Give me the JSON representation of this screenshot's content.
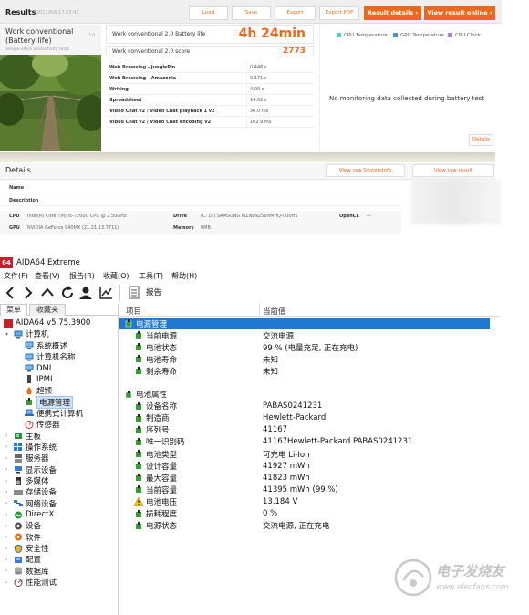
{
  "futuremark": {
    "header": {
      "title": "Results",
      "timestamp": "2017/6/6 17:53:41",
      "buttons": [
        "Load",
        "Save",
        "Export",
        "Export PDF"
      ],
      "result_details": "Result details",
      "view_online": "View result online"
    },
    "test_card": {
      "title_line1": "Work conventional",
      "title_line2": "(Battery life)",
      "subtitle": "Simple office productivity tests",
      "corner": "2.0"
    },
    "battery_life": {
      "label": "Work conventional 2.0 Battery life",
      "value": "4h 24min"
    },
    "score": {
      "label": "Work conventional 2.0 score",
      "value": "2773"
    },
    "subtests": [
      {
        "name": "Web Browsing - JunglePin",
        "value": "0.448 s"
      },
      {
        "name": "Web Browsing - Amazonia",
        "value": "0.171 s"
      },
      {
        "name": "Writing",
        "value": "4.00 s"
      },
      {
        "name": "Spreadsheet",
        "value": "14.02 s"
      },
      {
        "name": "Video Chat v2 / Video Chat playback 1 v2",
        "value": "30.0 fps"
      },
      {
        "name": "Video Chat v2 / Video Chat encoding v2",
        "value": "102.9 ms"
      }
    ],
    "monitoring": {
      "legend": [
        {
          "label": "CPU Temperature",
          "color": "#4fd0b8"
        },
        {
          "label": "GPU Temperature",
          "color": "#4f8fd6"
        },
        {
          "label": "CPU Clock",
          "color": "#b97ad6"
        }
      ],
      "empty_message": "No monitoring data collected during battery test",
      "details_button": "Details"
    },
    "details": {
      "title": "Details",
      "view_sysinfo": "View raw SystemInfo",
      "view_result": "View raw result",
      "name_label": "Name",
      "description_label": "Description",
      "cpu_label": "CPU",
      "cpu_value": "Intel(R) Core(TM) i5-7200U CPU @ 2.50GHz",
      "gpu_label": "GPU",
      "gpu_value": "NVIDIA GeForce 940MX (21.21.13.7711)",
      "drive_label": "Drive",
      "drive_value": "(C: D:) SAMSUNG MZNLN256HMHQ-000H1",
      "memory_label": "Memory",
      "memory_value": "0MB",
      "opencl_label": "OpenCL",
      "opencl_value": "---"
    }
  },
  "aida": {
    "app_badge": "64",
    "title": "AIDA64 Extreme",
    "menu": [
      "文件(F)",
      "查看(V)",
      "报告(R)",
      "收藏(O)",
      "工具(T)",
      "帮助(H)"
    ],
    "report_button": "报告",
    "sidebar_tabs": [
      "菜单",
      "收藏夹"
    ],
    "col_item": "项目",
    "col_value": "当前值",
    "tree": [
      {
        "label": "AIDA64 v5.75.3900",
        "level": 0,
        "icon": "aida-icon",
        "arrow": ""
      },
      {
        "label": "计算机",
        "level": 1,
        "icon": "computer-icon",
        "arrow": "▾"
      },
      {
        "label": "系统概述",
        "level": 2,
        "icon": "monitor-icon",
        "arrow": ""
      },
      {
        "label": "计算机名称",
        "level": 2,
        "icon": "monitor-icon",
        "arrow": ""
      },
      {
        "label": "DMI",
        "level": 2,
        "icon": "monitor-icon",
        "arrow": ""
      },
      {
        "label": "IPMI",
        "level": 2,
        "icon": "device-icon",
        "arrow": ""
      },
      {
        "label": "超频",
        "level": 2,
        "icon": "fire-icon",
        "arrow": ""
      },
      {
        "label": "电源管理",
        "level": 2,
        "icon": "power-icon",
        "arrow": "",
        "selected": true
      },
      {
        "label": "便携式计算机",
        "level": 2,
        "icon": "laptop-icon",
        "arrow": ""
      },
      {
        "label": "传感器",
        "level": 2,
        "icon": "sensor-icon",
        "arrow": ""
      },
      {
        "label": "主板",
        "level": 1,
        "icon": "motherboard-icon",
        "arrow": "›"
      },
      {
        "label": "操作系统",
        "level": 1,
        "icon": "windows-icon",
        "arrow": "›"
      },
      {
        "label": "服务器",
        "level": 1,
        "icon": "server-icon",
        "arrow": "›"
      },
      {
        "label": "显示设备",
        "level": 1,
        "icon": "display-icon",
        "arrow": "›"
      },
      {
        "label": "多媒体",
        "level": 1,
        "icon": "speaker-icon",
        "arrow": "›"
      },
      {
        "label": "存储设备",
        "level": 1,
        "icon": "storage-icon",
        "arrow": "›"
      },
      {
        "label": "网络设备",
        "level": 1,
        "icon": "network-icon",
        "arrow": "›"
      },
      {
        "label": "DirectX",
        "level": 1,
        "icon": "directx-icon",
        "arrow": "›"
      },
      {
        "label": "设备",
        "level": 1,
        "icon": "devices-icon",
        "arrow": "›"
      },
      {
        "label": "软件",
        "level": 1,
        "icon": "software-icon",
        "arrow": "›"
      },
      {
        "label": "安全性",
        "level": 1,
        "icon": "shield-icon",
        "arrow": "›"
      },
      {
        "label": "配置",
        "level": 1,
        "icon": "config-icon",
        "arrow": "›"
      },
      {
        "label": "数据库",
        "level": 1,
        "icon": "database-icon",
        "arrow": "›"
      },
      {
        "label": "性能测试",
        "level": 1,
        "icon": "benchmark-icon",
        "arrow": "›"
      }
    ],
    "groups": [
      {
        "title": "电源管理",
        "selected": true,
        "rows": [
          {
            "item": "当前电源",
            "value": "交流电源",
            "icon": "green"
          },
          {
            "item": "电池状态",
            "value": "99 % (电量充足, 正在充电)",
            "icon": "green"
          },
          {
            "item": "电池寿命",
            "value": "未知",
            "icon": "green"
          },
          {
            "item": "剩余寿命",
            "value": "未知",
            "icon": "green"
          }
        ]
      },
      {
        "title": "电池属性",
        "selected": false,
        "rows": [
          {
            "item": "设备名称",
            "value": "PABAS0241231",
            "icon": "green"
          },
          {
            "item": "制造商",
            "value": "Hewlett-Packard",
            "icon": "green"
          },
          {
            "item": "序列号",
            "value": "41167",
            "icon": "green"
          },
          {
            "item": "唯一识别码",
            "value": "41167Hewlett-Packard PABAS0241231",
            "icon": "green"
          },
          {
            "item": "电池类型",
            "value": "可充电 Li-Ion",
            "icon": "green"
          },
          {
            "item": "设计容量",
            "value": "41927 mWh",
            "icon": "green"
          },
          {
            "item": "最大容量",
            "value": "41823 mWh",
            "icon": "green"
          },
          {
            "item": "当前容量",
            "value": "41395 mWh  (99 %)",
            "icon": "green"
          },
          {
            "item": "电池电压",
            "value": "13.184 V",
            "icon": "warning"
          },
          {
            "item": "损耗程度",
            "value": "0 %",
            "icon": "green"
          },
          {
            "item": "电源状态",
            "value": "交流电源, 正在充电",
            "icon": "green"
          }
        ]
      }
    ]
  },
  "watermark": {
    "cn": "电子发烧友",
    "url": "www.elecfans.com"
  }
}
